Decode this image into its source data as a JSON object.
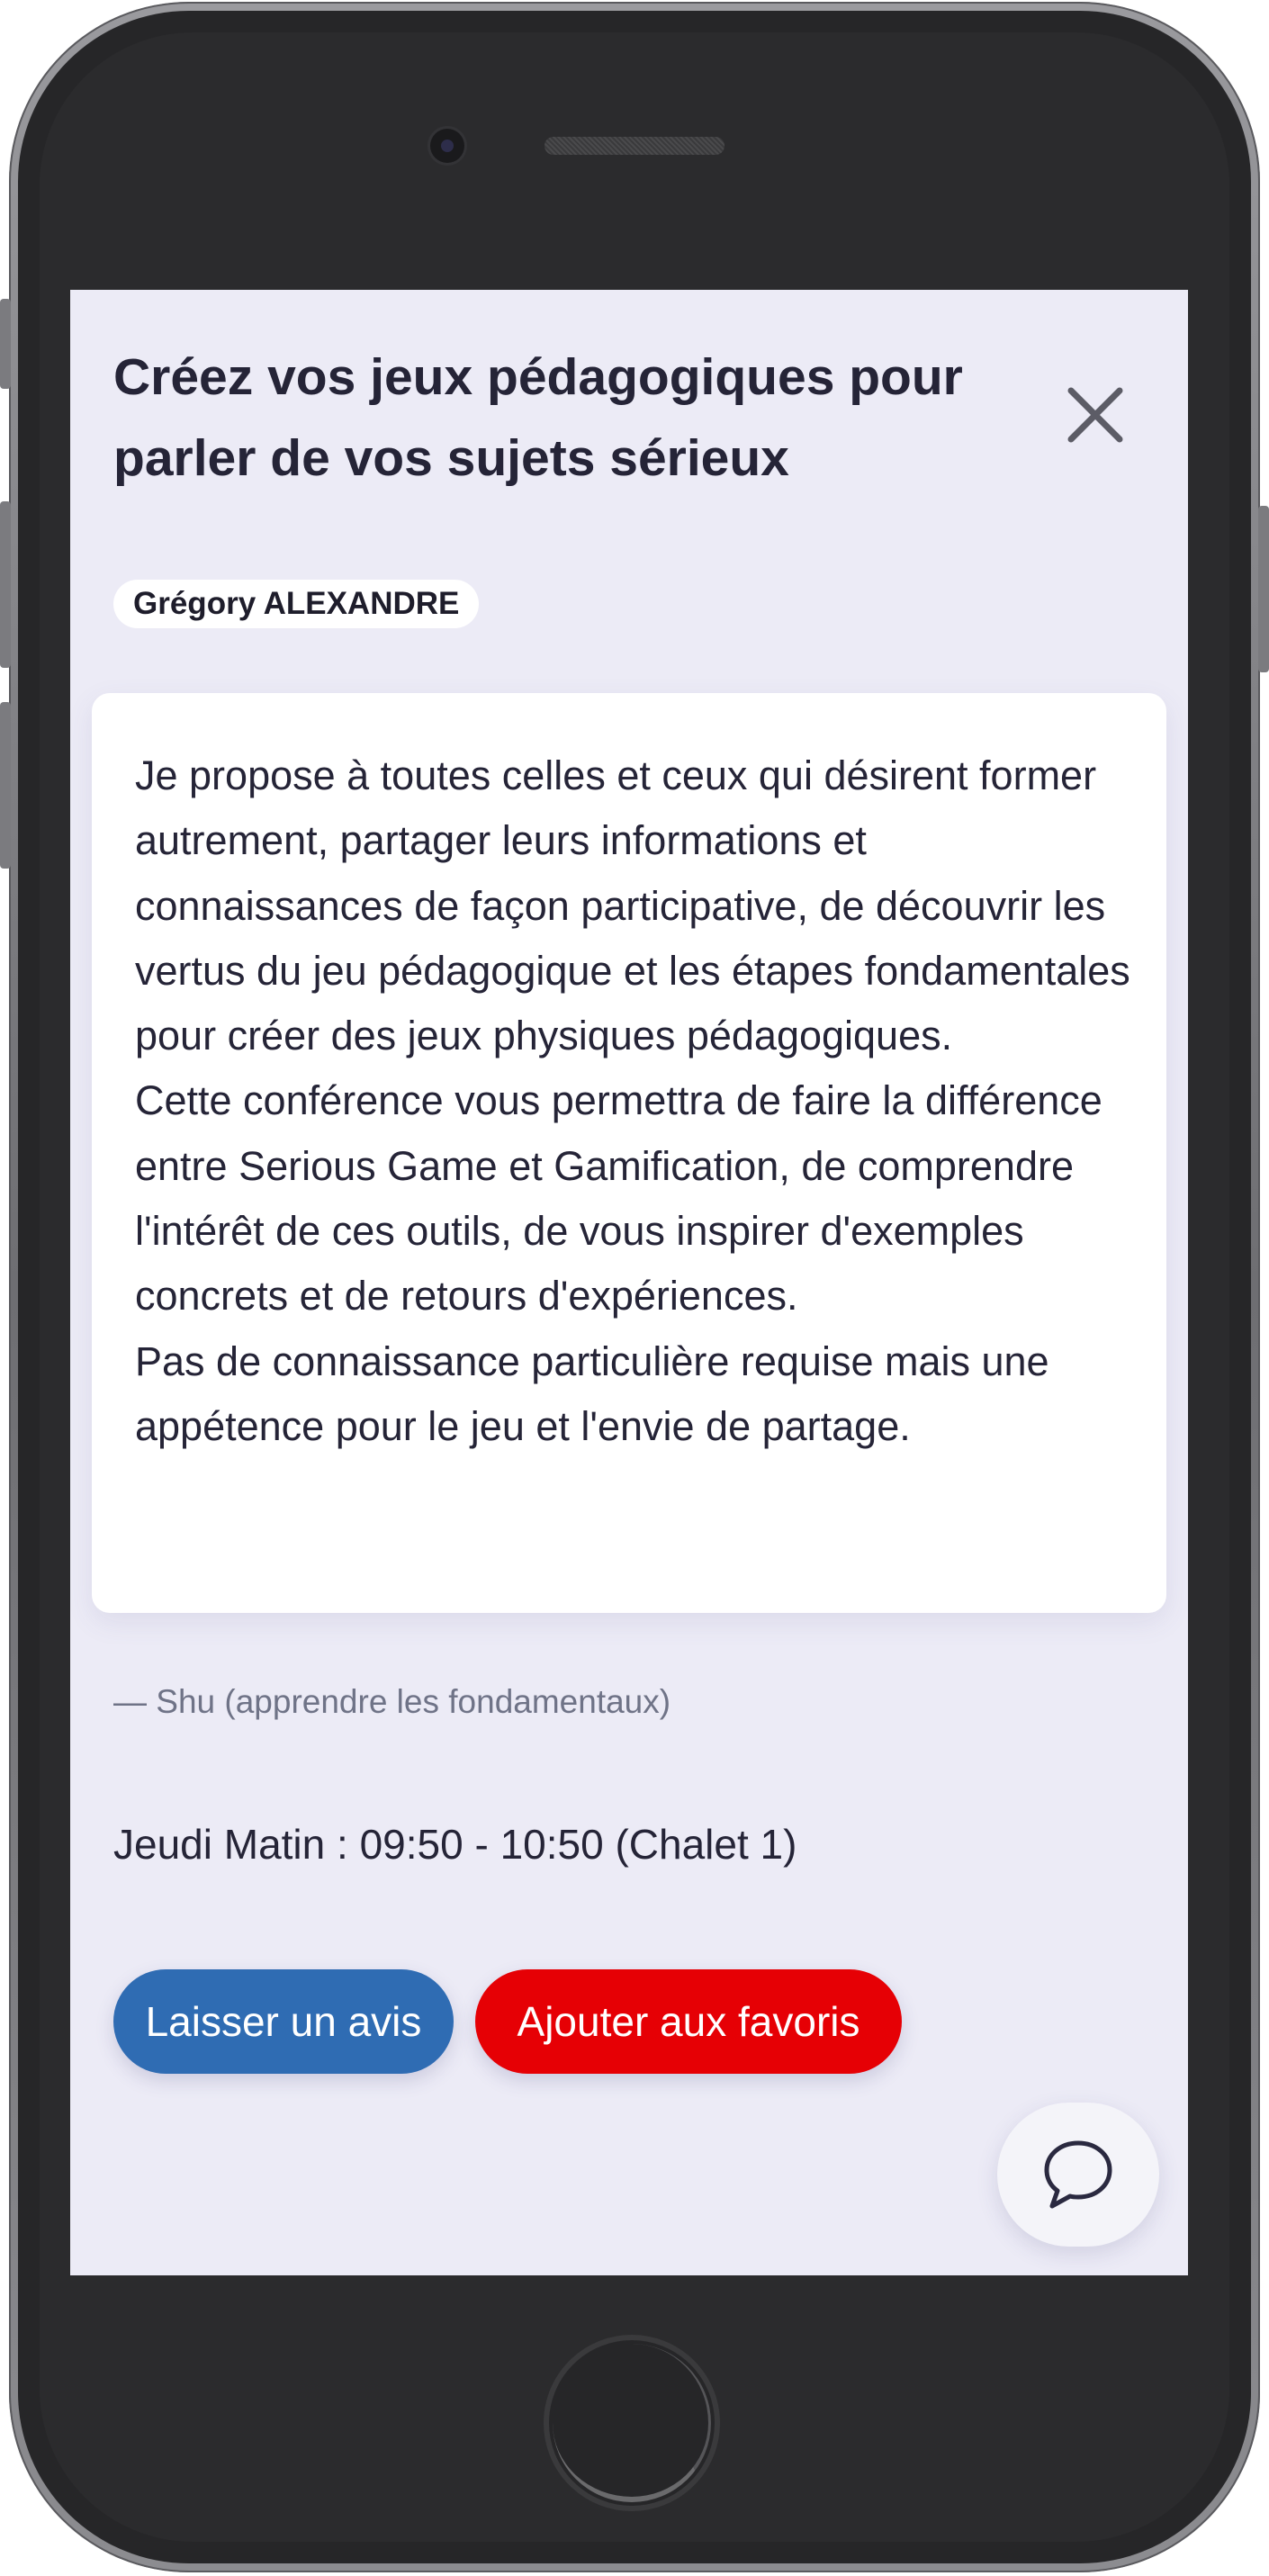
{
  "session": {
    "title": "Créez vos jeux pédagogiques pour parler de vos sujets sérieux",
    "speaker": "Grégory ALEXANDRE",
    "description": [
      "Je propose à toutes celles et ceux qui désirent former autrement, partager leurs informations et connaissances de façon participative, de découvrir les vertus du jeu pédagogique et les étapes fondamentales pour créer des jeux physiques pédagogiques.",
      "Cette conférence vous permettra de faire la différence entre Serious Game et Gamification, de comprendre l'intérêt de ces outils, de vous inspirer d'exemples concrets et de retours d'expériences.",
      "Pas de connaissance particulière requise mais une appétence pour le jeu et l'envie de partage."
    ],
    "level": "— Shu (apprendre les fondamentaux)",
    "schedule": "Jeudi Matin : 09:50 - 10:50 (Chalet 1)"
  },
  "actions": {
    "review_label": "Laisser un avis",
    "favorite_label": "Ajouter aux favoris"
  },
  "icons": {
    "close": "close-icon",
    "chat": "chat-bubble-icon"
  },
  "colors": {
    "background": "#ecebf6",
    "review_button": "#2f6cb3",
    "favorite_button": "#e60005",
    "text": "#252437"
  }
}
